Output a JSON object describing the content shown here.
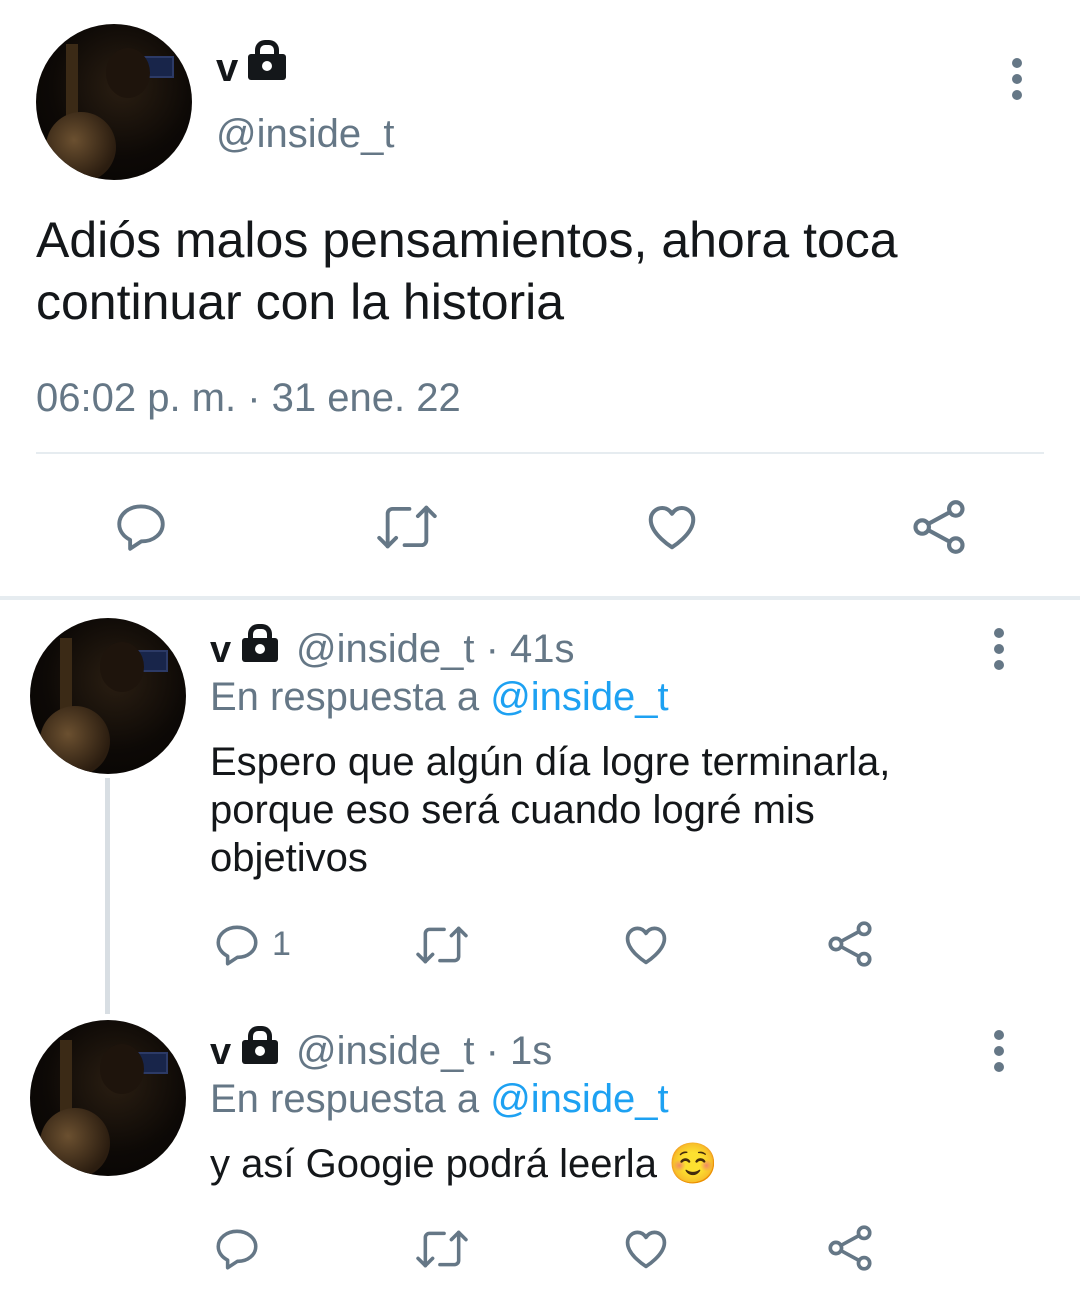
{
  "main_tweet": {
    "display_name": "v",
    "handle": "@inside_t",
    "text_line1": "Adiós malos pensamientos, ahora toca",
    "text_line2": "continuar con la historia",
    "timestamp": "06:02 p. m. · 31 ene. 22",
    "icons": [
      "comment-icon",
      "retweet-icon",
      "like-icon",
      "share-icon"
    ]
  },
  "replies": [
    {
      "display_name": "v",
      "handle": "@inside_t",
      "separator": " · ",
      "time": "41s",
      "reply_prefix": "En respuesta a ",
      "reply_to": "@inside_t",
      "text_line1": "Espero que algún día logre terminarla,",
      "text_line2": "porque eso será cuando logré mis",
      "text_line3": "objetivos",
      "reply_count": "1"
    },
    {
      "display_name": "v",
      "handle": "@inside_t",
      "separator": " · ",
      "time": "1s",
      "reply_prefix": "En respuesta a ",
      "reply_to": "@inside_t",
      "text_line1": "y así Googie podrá leerla ☺️",
      "reply_count": ""
    }
  ],
  "colors": {
    "primary_text": "#14171a",
    "secondary_text": "#657786",
    "link": "#1da1f2",
    "divider": "#e6ecf0"
  }
}
